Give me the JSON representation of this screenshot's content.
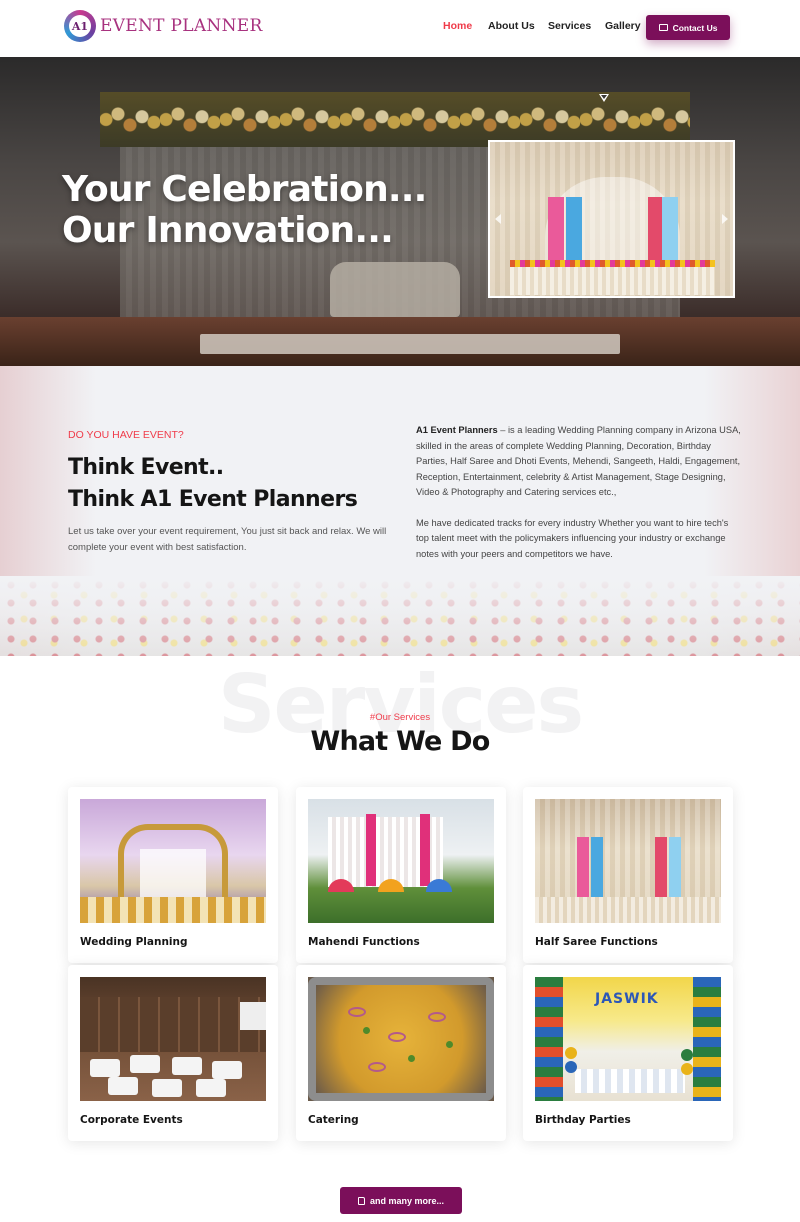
{
  "brand": {
    "logo_mark": "A1",
    "logo_text": "EVENT PLANNER",
    "accent": "#7b0f5a",
    "highlight": "#ef3b4a"
  },
  "nav": {
    "items": [
      {
        "label": "Home",
        "active": true
      },
      {
        "label": "About Us",
        "active": false
      },
      {
        "label": "Services",
        "active": false
      },
      {
        "label": "Gallery",
        "active": false
      }
    ],
    "contact_label": "Contact Us",
    "contact_icon": "mail-icon"
  },
  "hero": {
    "title_line1": "Your Celebration...",
    "title_line2": "Our Innovation...",
    "slider_image": "half-saree-stage-decoration",
    "scroll_top_icon": "arrow-up-icon"
  },
  "about": {
    "kicker": "DO YOU HAVE EVENT?",
    "title_line1": "Think Event..",
    "title_line2": "Think A1 Event Planners",
    "lead": "Let us take over your event requirement, You just sit back and relax. We will complete your event with best satisfaction.",
    "company_name": "A1 Event Planners",
    "paragraph1_rest": " – is a leading Wedding Planning company in Arizona USA, skilled in the areas of complete Wedding Planning, Decoration, Birthday Parties, Half Saree and Dhoti Events, Mehendi, Sangeeth, Haldi, Engagement, Reception, Entertainment, celebrity & Artist Management, Stage Designing, Video & Photography and Catering services etc.,",
    "paragraph2": "Me have dedicated tracks for every industry Whether you want to hire tech's top talent meet with the policymakers influencing your industry or exchange notes with your peers and competitors we have."
  },
  "services": {
    "background_word": "Services",
    "kicker": "#Our Services",
    "title": "What We Do",
    "cards": [
      {
        "label": "Wedding Planning"
      },
      {
        "label": "Mahendi Functions"
      },
      {
        "label": "Half Saree Functions"
      },
      {
        "label": "Corporate Events"
      },
      {
        "label": "Catering"
      },
      {
        "label": "Birthday Parties",
        "image_text": "JASWIK"
      }
    ],
    "more_label": "and many more...",
    "more_icon": "thumbs-up-icon"
  }
}
